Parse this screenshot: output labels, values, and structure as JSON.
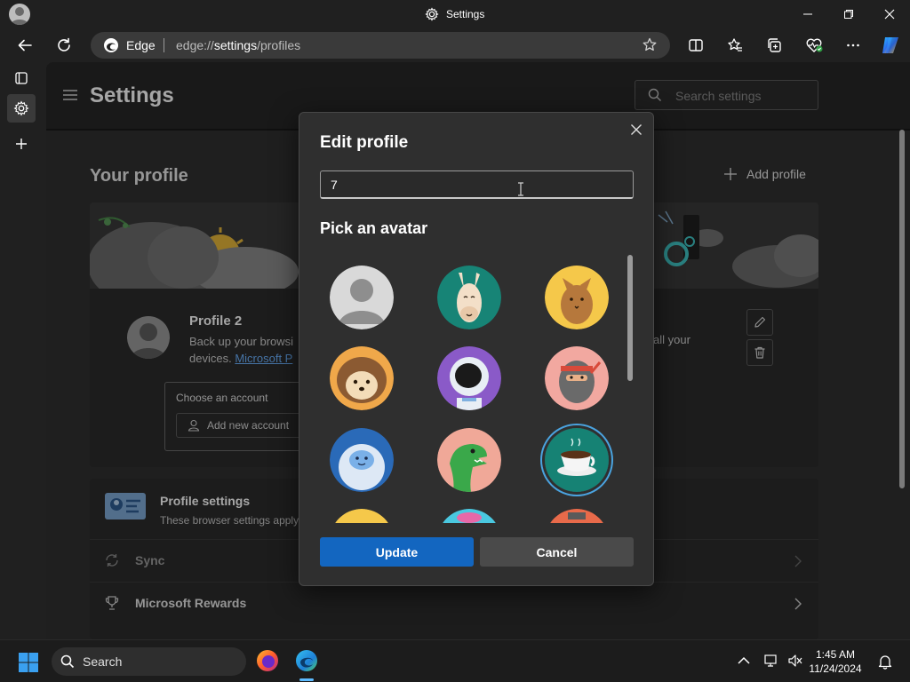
{
  "window": {
    "title": "Settings"
  },
  "addressbar": {
    "browser_label": "Edge",
    "url_scheme": "edge://",
    "url_host": "settings",
    "url_path": "/profiles"
  },
  "settings": {
    "title": "Settings",
    "search_placeholder": "Search settings",
    "section_title": "Your profile",
    "add_profile_label": "Add profile"
  },
  "profile": {
    "name": "Profile 2",
    "description_prefix": "Back up your browsi",
    "description_line2": "devices.",
    "description_link": "Microsoft P",
    "description_right": "all your",
    "choose_account_label": "Choose an account",
    "add_account_label": "Add new account"
  },
  "settings_list": {
    "profile_settings_title": "Profile settings",
    "profile_settings_desc": "These browser settings apply",
    "items": [
      {
        "label": "Sync",
        "icon": "sync-icon"
      },
      {
        "label": "Microsoft Rewards",
        "icon": "trophy-icon"
      }
    ]
  },
  "dialog": {
    "title": "Edit profile",
    "name_value": "7",
    "pick_avatar_label": "Pick an avatar",
    "update_label": "Update",
    "cancel_label": "Cancel",
    "avatars": [
      {
        "name": "default-person-avatar",
        "selected": false
      },
      {
        "name": "llama-avatar",
        "selected": false
      },
      {
        "name": "cat-avatar",
        "selected": false
      },
      {
        "name": "hedgehog-avatar",
        "selected": false
      },
      {
        "name": "astronaut-avatar",
        "selected": false
      },
      {
        "name": "ninja-avatar",
        "selected": false
      },
      {
        "name": "yeti-avatar",
        "selected": false
      },
      {
        "name": "dinosaur-avatar",
        "selected": false
      },
      {
        "name": "coffee-cup-avatar",
        "selected": true
      }
    ]
  },
  "taskbar": {
    "search_placeholder": "Search",
    "time": "1:45 AM",
    "date": "11/24/2024"
  },
  "colors": {
    "accent": "#1366c0",
    "link": "#6cb2ff",
    "selected_ring": "#4aa3df"
  }
}
